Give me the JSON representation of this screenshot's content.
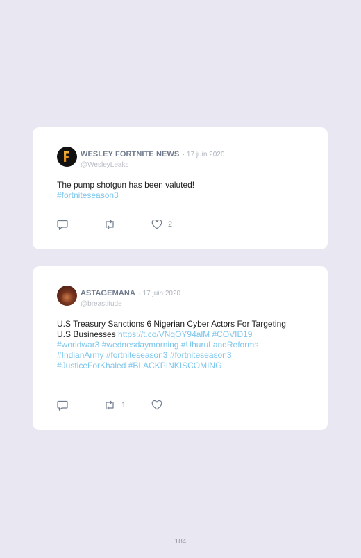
{
  "tweets": [
    {
      "name": "WESLEY FORTNITE NEWS",
      "date": "· 17 juin 2020",
      "handle": "@WesleyLeaks",
      "text": "The pump shotgun has been valuted!",
      "links": [
        "#fortniteseason3"
      ],
      "replies": "",
      "retweets": "",
      "likes": "2"
    },
    {
      "name": "ASTAGEMANA",
      "date": "· 17 juin 2020",
      "handle": "@breastitude",
      "text": "U.S Treasury Sanctions 6 Nigerian Cyber Actors For Targeting U.S Businesses",
      "links": [
        "https://t.co/VNqOY94alM",
        "#COVID19",
        "#worldwar3",
        "#wednesdaymorning",
        "#UhuruLandReforms",
        "#IndianArmy",
        "#fortniteseason3",
        "#fortniteseason3",
        "#JusticeForKhaled",
        "#BLACKPINKISCOMING"
      ],
      "replies": "",
      "retweets": "1",
      "likes": ""
    }
  ],
  "page_number": "184",
  "icons": {
    "reply": "reply-icon",
    "retweet": "retweet-icon",
    "like": "heart-icon"
  },
  "colors": {
    "background": "#e9e7f1",
    "link": "#7cc6ec"
  }
}
